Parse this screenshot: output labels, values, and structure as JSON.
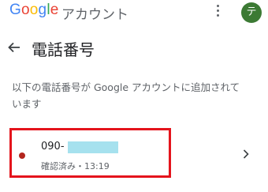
{
  "header": {
    "logo": {
      "g": "G",
      "o1": "o",
      "o2": "o",
      "g2": "g",
      "l": "l",
      "e": "e"
    },
    "account_label": "アカウント",
    "avatar_initial": "テ"
  },
  "page": {
    "title": "電話番号",
    "description": "以下の電話番号が Google アカウントに追加されています"
  },
  "phone_entry": {
    "number_prefix": "090-",
    "status": "確認済み・13:19"
  },
  "colors": {
    "avatar_bg": "#3c7a34",
    "highlight_border": "#e4141c",
    "redaction": "#a6e1ee",
    "status_dot": "#b3261e"
  }
}
